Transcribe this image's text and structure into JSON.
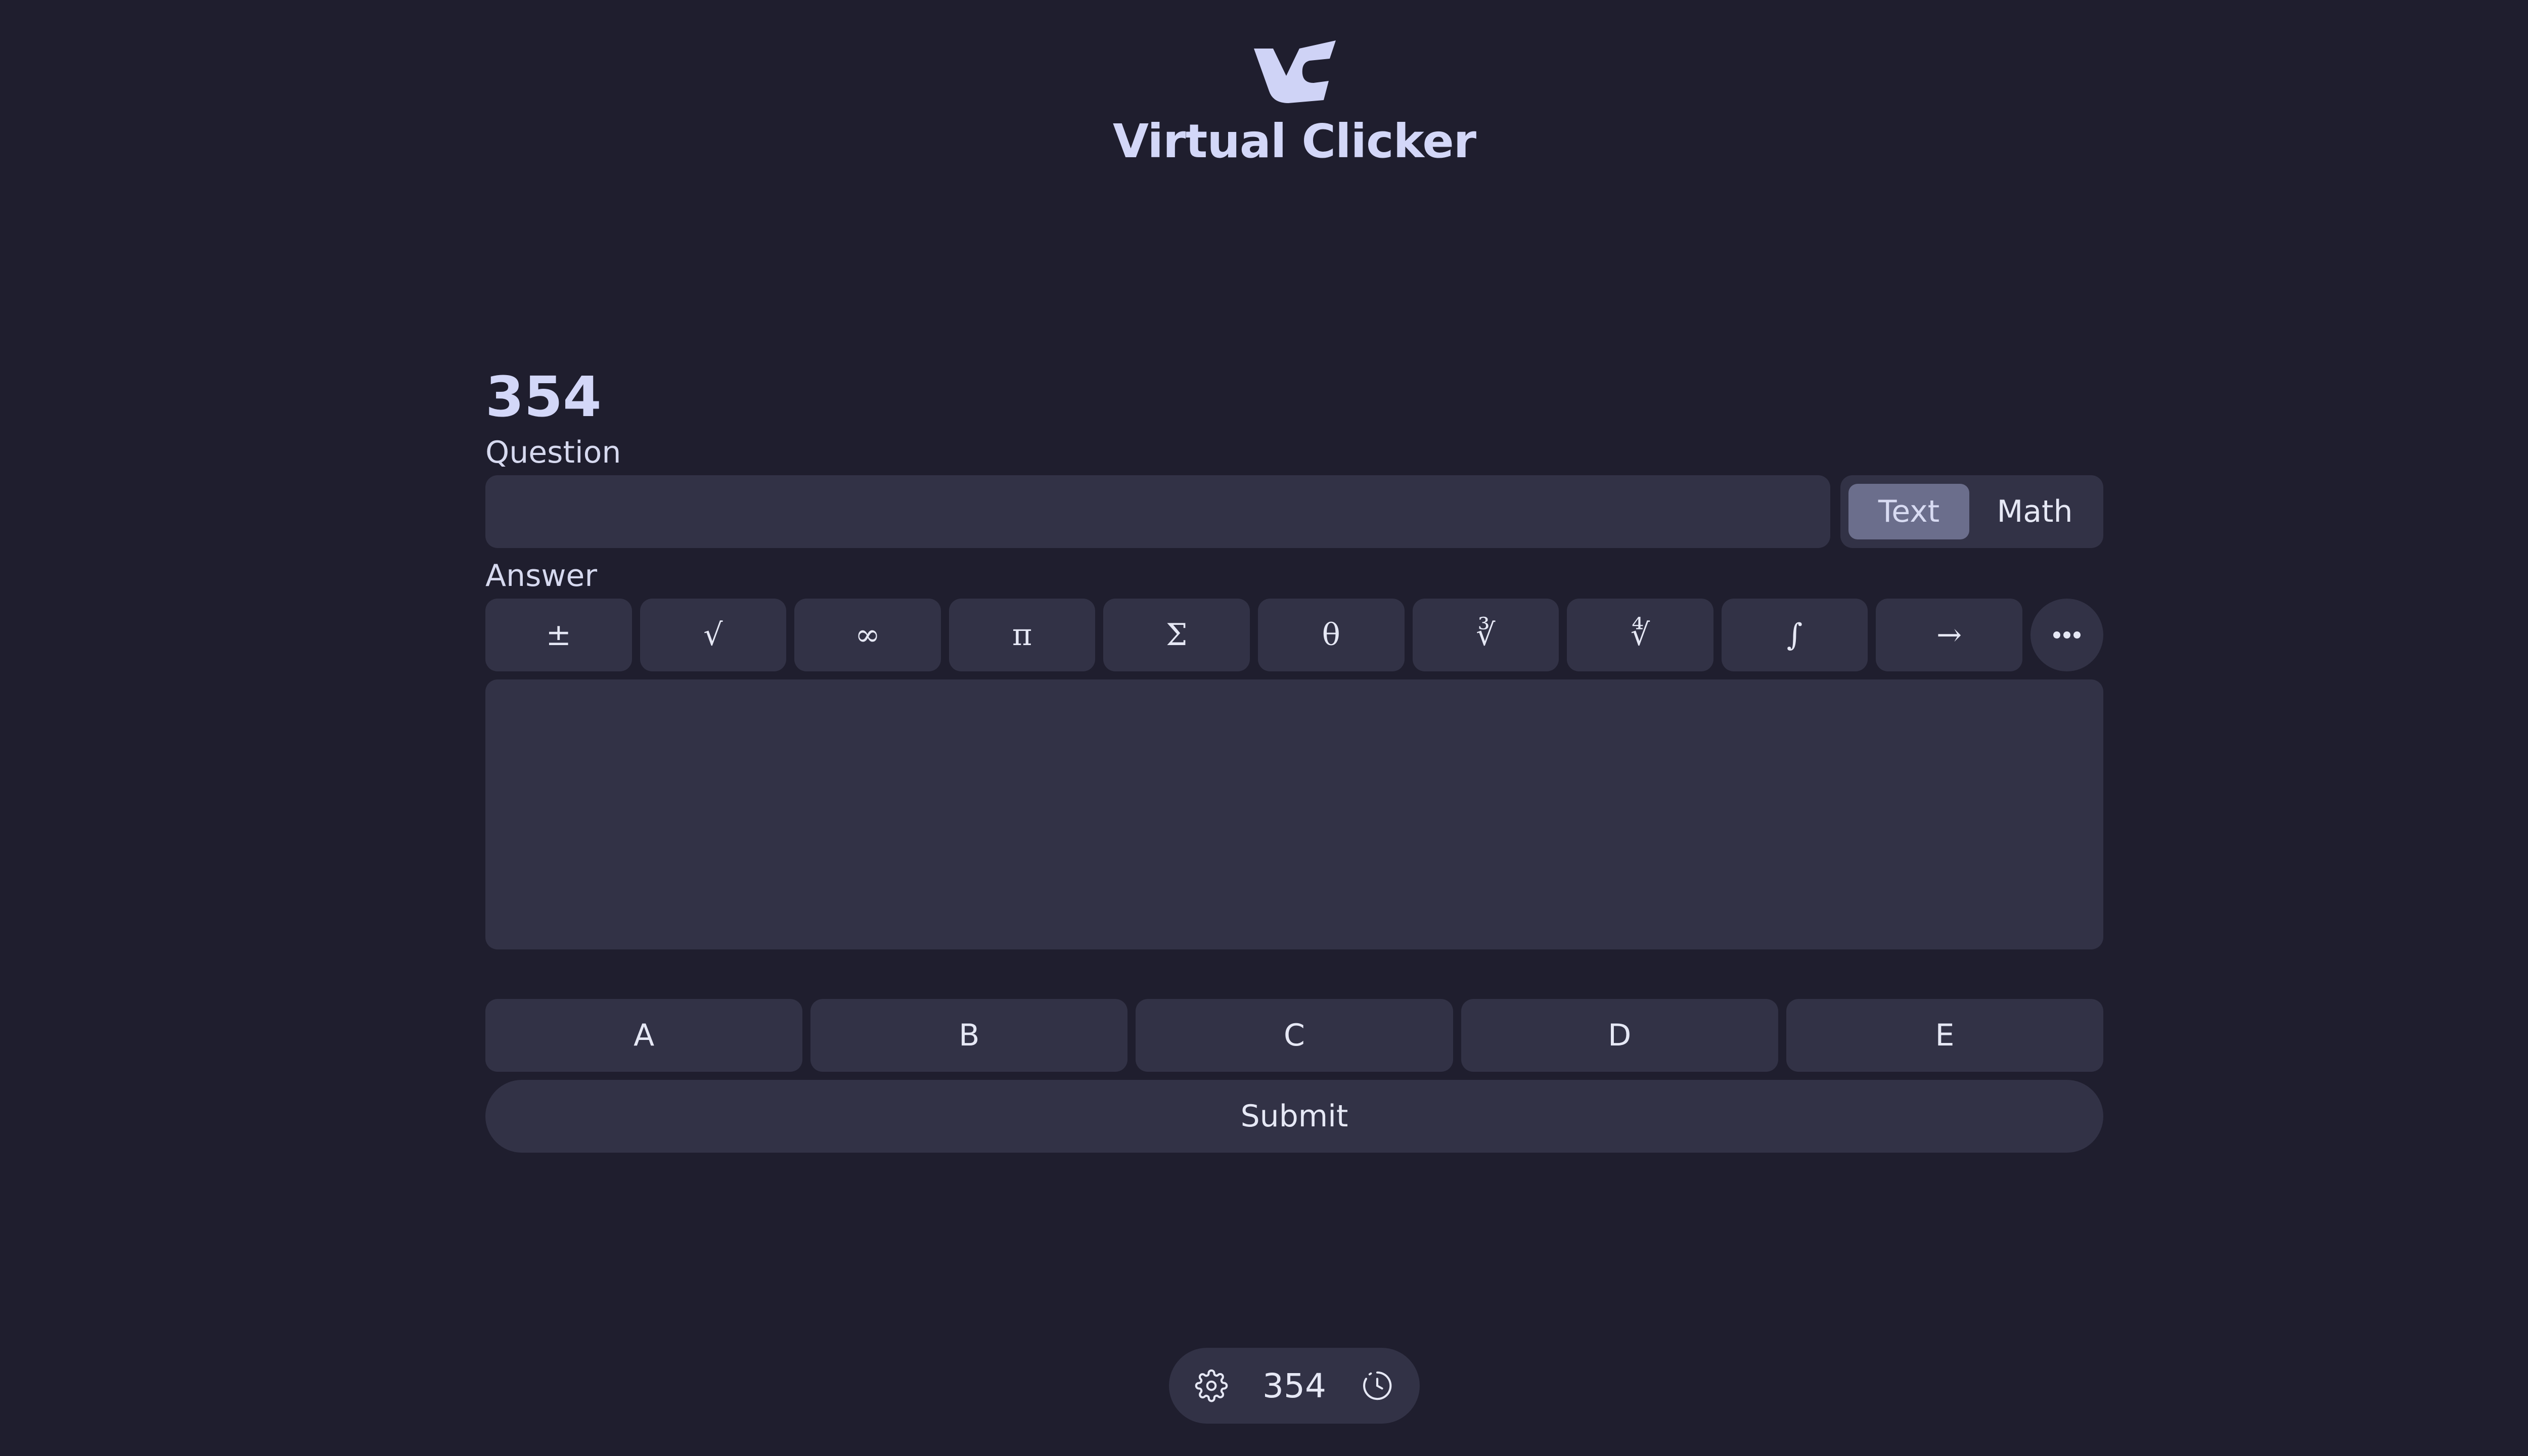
{
  "app": {
    "title": "Virtual Clicker",
    "logo_icon": "vc-logo-icon"
  },
  "main": {
    "number": "354",
    "question_label": "Question",
    "question_value": "",
    "modes": [
      {
        "label": "Text",
        "active": true
      },
      {
        "label": "Math",
        "active": false
      }
    ],
    "answer_label": "Answer",
    "symbols": [
      "±",
      "√",
      "∞",
      "π",
      "Σ",
      "θ",
      "∛",
      "∜",
      "∫",
      "→"
    ],
    "more_icon": "ellipsis-icon",
    "answer_value": "",
    "choices": [
      "A",
      "B",
      "C",
      "D",
      "E"
    ],
    "submit_label": "Submit"
  },
  "bottom_bar": {
    "settings_icon": "gear-icon",
    "number": "354",
    "history_icon": "clock-icon"
  },
  "colors": {
    "background": "#1f1e2e",
    "surface": "#323246",
    "accent": "#d3d7f8",
    "active_toggle": "#6b6e8c"
  }
}
